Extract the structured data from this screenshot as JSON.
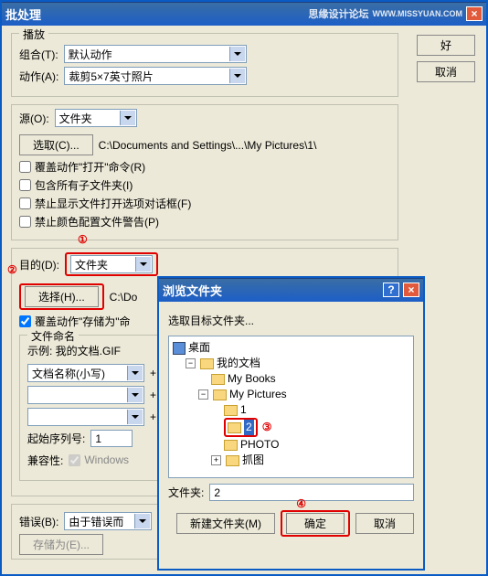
{
  "main": {
    "title": "批处理",
    "watermark": "思缘设计论坛",
    "wm_url": "WWW.MISSYUAN.COM",
    "ok": "好",
    "cancel": "取消",
    "play": {
      "legend": "播放",
      "set_lbl": "组合(T):",
      "set_val": "默认动作",
      "act_lbl": "动作(A):",
      "act_val": "裁剪5×7英寸照片"
    },
    "src": {
      "legend_lbl": "源(O):",
      "legend_val": "文件夹",
      "choose": "选取(C)...",
      "path": "C:\\Documents and Settings\\...\\My Pictures\\1\\",
      "ck1": "覆盖动作\"打开\"命令(R)",
      "ck2": "包含所有子文件夹(I)",
      "ck3": "禁止显示文件打开选项对话框(F)",
      "ck4": "禁止颜色配置文件警告(P)"
    },
    "dest": {
      "lbl": "目的(D):",
      "val": "文件夹",
      "num1": "①",
      "num2": "②",
      "choose": "选择(H)...",
      "path": "C:\\Do",
      "ck": "覆盖动作\"存储为\"命",
      "naming": "文件命名",
      "example": "示例: 我的文档.GIF",
      "fn": "文档名称(小写)",
      "plus": "+",
      "start_lbl": "起始序列号:",
      "start_val": "1",
      "compat_lbl": "兼容性:",
      "compat_win": "Windows"
    },
    "err": {
      "lbl": "错误(B):",
      "val": "由于错误而",
      "save": "存储为(E)..."
    }
  },
  "browse": {
    "title": "浏览文件夹",
    "prompt": "选取目标文件夹...",
    "tree": {
      "desktop": "桌面",
      "docs": "我的文档",
      "books": "My Books",
      "pics": "My Pictures",
      "f1": "1",
      "f2": "2",
      "photo": "PHOTO",
      "cap": "抓图"
    },
    "num3": "③",
    "num4": "④",
    "fl_lbl": "文件夹:",
    "fl_val": "2",
    "newf": "新建文件夹(M)",
    "ok": "确定",
    "cancel": "取消"
  }
}
